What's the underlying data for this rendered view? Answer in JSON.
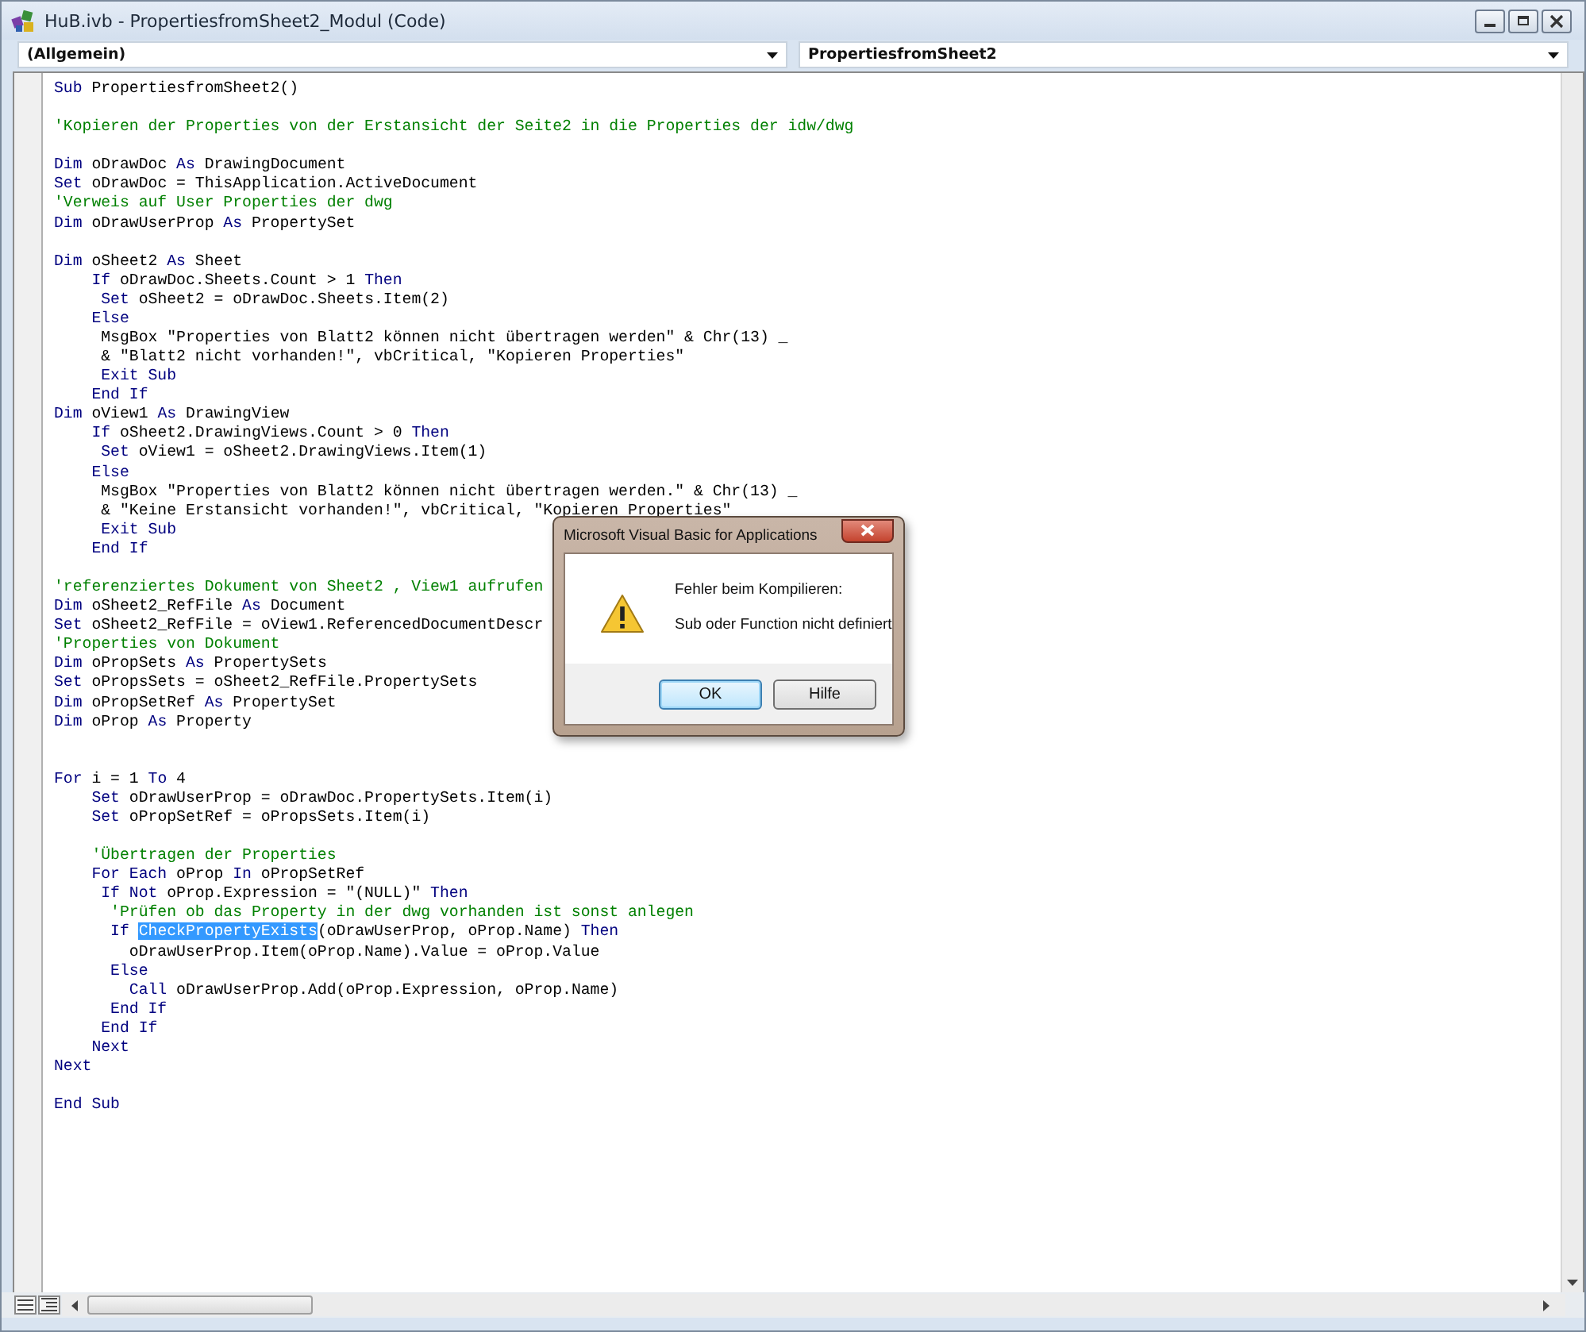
{
  "window": {
    "title": "HuB.ivb - PropertiesfromSheet2_Modul (Code)"
  },
  "object_dropdown": {
    "value": "(Allgemein)"
  },
  "procedure_dropdown": {
    "value": "PropertiesfromSheet2"
  },
  "code_lines": [
    {
      "kind": "code",
      "segments": [
        {
          "kind": "keyword",
          "text": "Sub"
        },
        {
          "kind": "plain",
          "text": " PropertiesfromSheet2()"
        }
      ]
    },
    {
      "kind": "blank"
    },
    {
      "kind": "code",
      "segments": [
        {
          "kind": "comment",
          "text": "'Kopieren der Properties von der Erstansicht der Seite2 in die Properties der idw/dwg"
        }
      ]
    },
    {
      "kind": "blank"
    },
    {
      "kind": "code",
      "segments": [
        {
          "kind": "keyword",
          "text": "Dim"
        },
        {
          "kind": "plain",
          "text": " oDrawDoc "
        },
        {
          "kind": "keyword",
          "text": "As"
        },
        {
          "kind": "plain",
          "text": " DrawingDocument"
        }
      ]
    },
    {
      "kind": "code",
      "segments": [
        {
          "kind": "keyword",
          "text": "Set"
        },
        {
          "kind": "plain",
          "text": " oDrawDoc = ThisApplication.ActiveDocument"
        }
      ]
    },
    {
      "kind": "code",
      "segments": [
        {
          "kind": "comment",
          "text": "'Verweis auf User Properties der dwg"
        }
      ]
    },
    {
      "kind": "code",
      "segments": [
        {
          "kind": "keyword",
          "text": "Dim"
        },
        {
          "kind": "plain",
          "text": " oDrawUserProp "
        },
        {
          "kind": "keyword",
          "text": "As"
        },
        {
          "kind": "plain",
          "text": " PropertySet"
        }
      ]
    },
    {
      "kind": "blank"
    },
    {
      "kind": "code",
      "segments": [
        {
          "kind": "keyword",
          "text": "Dim"
        },
        {
          "kind": "plain",
          "text": " oSheet2 "
        },
        {
          "kind": "keyword",
          "text": "As"
        },
        {
          "kind": "plain",
          "text": " Sheet"
        }
      ]
    },
    {
      "kind": "code",
      "segments": [
        {
          "kind": "keyword",
          "text": "    If"
        },
        {
          "kind": "plain",
          "text": " oDrawDoc.Sheets.Count > 1 "
        },
        {
          "kind": "keyword",
          "text": "Then"
        }
      ]
    },
    {
      "kind": "code",
      "segments": [
        {
          "kind": "keyword",
          "text": "     Set"
        },
        {
          "kind": "plain",
          "text": " oSheet2 = oDrawDoc.Sheets.Item(2)"
        }
      ]
    },
    {
      "kind": "code",
      "segments": [
        {
          "kind": "keyword",
          "text": "    Else"
        }
      ]
    },
    {
      "kind": "code",
      "segments": [
        {
          "kind": "plain",
          "text": "     MsgBox \"Properties von Blatt2 können nicht übertragen werden\" & Chr(13) _"
        }
      ]
    },
    {
      "kind": "code",
      "segments": [
        {
          "kind": "plain",
          "text": "     & \"Blatt2 nicht vorhanden!\", vbCritical, \"Kopieren Properties\""
        }
      ]
    },
    {
      "kind": "code",
      "segments": [
        {
          "kind": "keyword",
          "text": "     Exit Sub"
        }
      ]
    },
    {
      "kind": "code",
      "segments": [
        {
          "kind": "keyword",
          "text": "    End If"
        }
      ]
    },
    {
      "kind": "code",
      "segments": [
        {
          "kind": "keyword",
          "text": "Dim"
        },
        {
          "kind": "plain",
          "text": " oView1 "
        },
        {
          "kind": "keyword",
          "text": "As"
        },
        {
          "kind": "plain",
          "text": " DrawingView"
        }
      ]
    },
    {
      "kind": "code",
      "segments": [
        {
          "kind": "keyword",
          "text": "    If"
        },
        {
          "kind": "plain",
          "text": " oSheet2.DrawingViews.Count > 0 "
        },
        {
          "kind": "keyword",
          "text": "Then"
        }
      ]
    },
    {
      "kind": "code",
      "segments": [
        {
          "kind": "keyword",
          "text": "     Set"
        },
        {
          "kind": "plain",
          "text": " oView1 = oSheet2.DrawingViews.Item(1)"
        }
      ]
    },
    {
      "kind": "code",
      "segments": [
        {
          "kind": "keyword",
          "text": "    Else"
        }
      ]
    },
    {
      "kind": "code",
      "segments": [
        {
          "kind": "plain",
          "text": "     MsgBox \"Properties von Blatt2 können nicht übertragen werden.\" & Chr(13) _"
        }
      ]
    },
    {
      "kind": "code",
      "segments": [
        {
          "kind": "plain",
          "text": "     & \"Keine Erstansicht vorhanden!\", vbCritical, \"Kopieren Properties\""
        }
      ]
    },
    {
      "kind": "code",
      "segments": [
        {
          "kind": "keyword",
          "text": "     Exit Sub"
        }
      ]
    },
    {
      "kind": "code",
      "segments": [
        {
          "kind": "keyword",
          "text": "    End If"
        }
      ]
    },
    {
      "kind": "blank"
    },
    {
      "kind": "code",
      "segments": [
        {
          "kind": "comment",
          "text": "'referenziertes Dokument von Sheet2 , View1 aufrufen"
        }
      ]
    },
    {
      "kind": "code",
      "segments": [
        {
          "kind": "keyword",
          "text": "Dim"
        },
        {
          "kind": "plain",
          "text": " oSheet2_RefFile "
        },
        {
          "kind": "keyword",
          "text": "As"
        },
        {
          "kind": "plain",
          "text": " Document"
        }
      ]
    },
    {
      "kind": "code",
      "segments": [
        {
          "kind": "keyword",
          "text": "Set"
        },
        {
          "kind": "plain",
          "text": " oSheet2_RefFile = oView1.ReferencedDocumentDescr"
        }
      ]
    },
    {
      "kind": "code",
      "segments": [
        {
          "kind": "comment",
          "text": "'Properties von Dokument"
        }
      ]
    },
    {
      "kind": "code",
      "segments": [
        {
          "kind": "keyword",
          "text": "Dim"
        },
        {
          "kind": "plain",
          "text": " oPropSets "
        },
        {
          "kind": "keyword",
          "text": "As"
        },
        {
          "kind": "plain",
          "text": " PropertySets"
        }
      ]
    },
    {
      "kind": "code",
      "segments": [
        {
          "kind": "keyword",
          "text": "Set"
        },
        {
          "kind": "plain",
          "text": " oPropsSets = oSheet2_RefFile.PropertySets"
        }
      ]
    },
    {
      "kind": "code",
      "segments": [
        {
          "kind": "keyword",
          "text": "Dim"
        },
        {
          "kind": "plain",
          "text": " oPropSetRef "
        },
        {
          "kind": "keyword",
          "text": "As"
        },
        {
          "kind": "plain",
          "text": " PropertySet"
        }
      ]
    },
    {
      "kind": "code",
      "segments": [
        {
          "kind": "keyword",
          "text": "Dim"
        },
        {
          "kind": "plain",
          "text": " oProp "
        },
        {
          "kind": "keyword",
          "text": "As"
        },
        {
          "kind": "plain",
          "text": " Property"
        }
      ]
    },
    {
      "kind": "blank"
    },
    {
      "kind": "blank"
    },
    {
      "kind": "code",
      "segments": [
        {
          "kind": "keyword",
          "text": "For"
        },
        {
          "kind": "plain",
          "text": " i = 1 "
        },
        {
          "kind": "keyword",
          "text": "To"
        },
        {
          "kind": "plain",
          "text": " 4"
        }
      ]
    },
    {
      "kind": "code",
      "segments": [
        {
          "kind": "keyword",
          "text": "    Set"
        },
        {
          "kind": "plain",
          "text": " oDrawUserProp = oDrawDoc.PropertySets.Item(i)"
        }
      ]
    },
    {
      "kind": "code",
      "segments": [
        {
          "kind": "keyword",
          "text": "    Set"
        },
        {
          "kind": "plain",
          "text": " oPropSetRef = oPropsSets.Item(i)"
        }
      ]
    },
    {
      "kind": "blank"
    },
    {
      "kind": "code",
      "segments": [
        {
          "kind": "comment",
          "text": "    'Übertragen der Properties"
        }
      ]
    },
    {
      "kind": "code",
      "segments": [
        {
          "kind": "keyword",
          "text": "    For Each"
        },
        {
          "kind": "plain",
          "text": " oProp "
        },
        {
          "kind": "keyword",
          "text": "In"
        },
        {
          "kind": "plain",
          "text": " oPropSetRef"
        }
      ]
    },
    {
      "kind": "code",
      "segments": [
        {
          "kind": "keyword",
          "text": "     If Not"
        },
        {
          "kind": "plain",
          "text": " oProp.Expression = \"(NULL)\" "
        },
        {
          "kind": "keyword",
          "text": "Then"
        }
      ]
    },
    {
      "kind": "code",
      "segments": [
        {
          "kind": "comment",
          "text": "      'Prüfen ob das Property in der dwg vorhanden ist sonst anlegen"
        }
      ]
    },
    {
      "kind": "code",
      "segments": [
        {
          "kind": "keyword",
          "text": "      If "
        },
        {
          "kind": "selection",
          "text": "CheckPropertyExists"
        },
        {
          "kind": "plain",
          "text": "(oDrawUserProp, oProp.Name) "
        },
        {
          "kind": "keyword",
          "text": "Then"
        }
      ]
    },
    {
      "kind": "code",
      "segments": [
        {
          "kind": "plain",
          "text": "        oDrawUserProp.Item(oProp.Name).Value = oProp.Value"
        }
      ]
    },
    {
      "kind": "code",
      "segments": [
        {
          "kind": "keyword",
          "text": "      Else"
        }
      ]
    },
    {
      "kind": "code",
      "segments": [
        {
          "kind": "keyword",
          "text": "        Call"
        },
        {
          "kind": "plain",
          "text": " oDrawUserProp.Add(oProp.Expression, oProp.Name)"
        }
      ]
    },
    {
      "kind": "code",
      "segments": [
        {
          "kind": "keyword",
          "text": "      End If"
        }
      ]
    },
    {
      "kind": "code",
      "segments": [
        {
          "kind": "keyword",
          "text": "     End If"
        }
      ]
    },
    {
      "kind": "code",
      "segments": [
        {
          "kind": "keyword",
          "text": "    Next"
        }
      ]
    },
    {
      "kind": "code",
      "segments": [
        {
          "kind": "keyword",
          "text": "Next"
        }
      ]
    },
    {
      "kind": "blank"
    },
    {
      "kind": "code",
      "segments": [
        {
          "kind": "keyword",
          "text": "End Sub"
        }
      ]
    }
  ],
  "dialog": {
    "title": "Microsoft Visual Basic for Applications",
    "message": "Fehler beim Kompilieren:",
    "detail": "Sub oder Function nicht definiert",
    "buttons": [
      {
        "label": "OK",
        "selected": true
      },
      {
        "label": "Hilfe",
        "selected": false
      }
    ]
  }
}
